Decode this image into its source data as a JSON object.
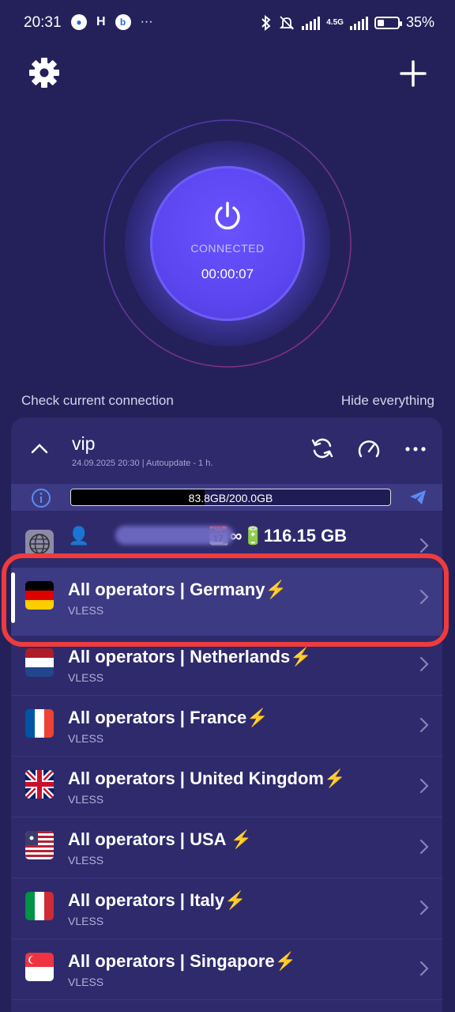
{
  "status_bar": {
    "time": "20:31",
    "network": "4.5G",
    "battery": "35%",
    "battery_level": 0.35,
    "more": "···"
  },
  "header": {
    "settings_icon": "gear-icon",
    "add_icon": "plus-icon"
  },
  "connection": {
    "status": "CONNECTED",
    "timer": "00:00:07",
    "power_icon": "power-icon"
  },
  "links": {
    "check": "Check current connection",
    "hide": "Hide everything"
  },
  "group": {
    "name": "vip",
    "subtitle": "24.09.2025 20:30 | Autoupdate - 1 h.",
    "usage_text": "83.8GB/200.0GB",
    "usage_fraction": 0.419
  },
  "servers": [
    {
      "name": "👤 ... 📆∞🔋116.15 GB",
      "visible_suffix": "📆∞🔋116.15 GB",
      "protocol": "",
      "flag": "globe"
    },
    {
      "name": "All operators | Germany⚡",
      "protocol": "VLESS",
      "flag": "de"
    },
    {
      "name": "All operators | Netherlands⚡",
      "protocol": "VLESS",
      "flag": "nl"
    },
    {
      "name": "All operators | France⚡",
      "protocol": "VLESS",
      "flag": "fr"
    },
    {
      "name": "All operators | United Kingdom⚡",
      "protocol": "VLESS",
      "flag": "gb"
    },
    {
      "name": "All operators | USA ⚡",
      "protocol": "VLESS",
      "flag": "us"
    },
    {
      "name": "All operators | Italy⚡",
      "protocol": "VLESS",
      "flag": "it"
    },
    {
      "name": "All operators | Singapore⚡",
      "protocol": "VLESS",
      "flag": "sg"
    }
  ],
  "colors": {
    "background": "#24215a",
    "panel": "#2e2a6c",
    "selected": "#3d3a84",
    "accent": "#5b46f0",
    "highlight": "#ee3b3d"
  }
}
